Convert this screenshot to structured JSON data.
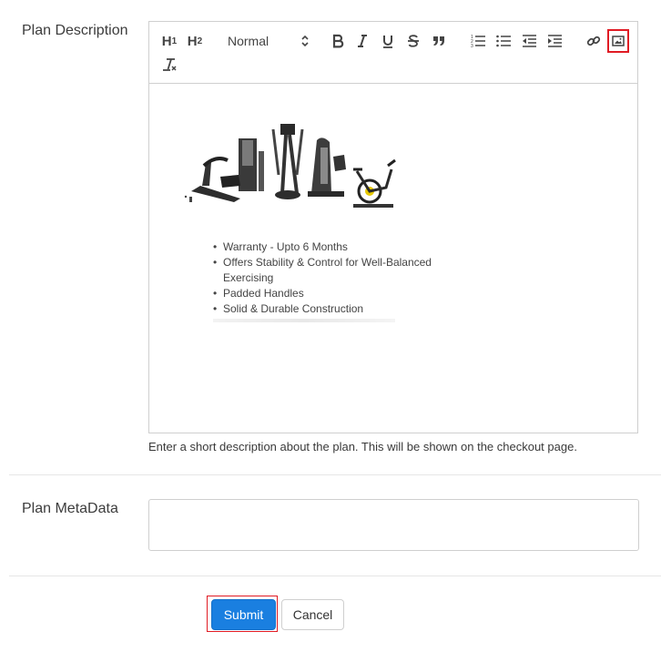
{
  "form": {
    "plan_description_label": "Plan Description",
    "plan_metadata_label": "Plan MetaData",
    "help_text": "Enter a short description about the plan. This will be shown on the checkout page.",
    "metadata_value": ""
  },
  "toolbar": {
    "h1_label": "H",
    "h1_sub": "1",
    "h2_label": "H",
    "h2_sub": "2",
    "format_select": "Normal",
    "icons": [
      "bold-icon",
      "italic-icon",
      "underline-icon",
      "strike-icon",
      "blockquote-icon",
      "ordered-list-icon",
      "bullet-list-icon",
      "outdent-icon",
      "indent-icon",
      "link-icon",
      "image-icon",
      "clear-format-icon"
    ]
  },
  "editor": {
    "image_alt": "Gym equipment: treadmill, multi-gym, elliptical, cable machine, exercise bike",
    "bullets": [
      "Warranty - Upto 6 Months",
      "Offers Stability & Control for Well-Balanced Exercising",
      "Padded Handles",
      "Solid & Durable Construction"
    ]
  },
  "actions": {
    "submit_label": "Submit",
    "cancel_label": "Cancel"
  },
  "colors": {
    "primary": "#1a7fe0",
    "highlight": "#e01b24",
    "border": "#cfcfcf"
  }
}
